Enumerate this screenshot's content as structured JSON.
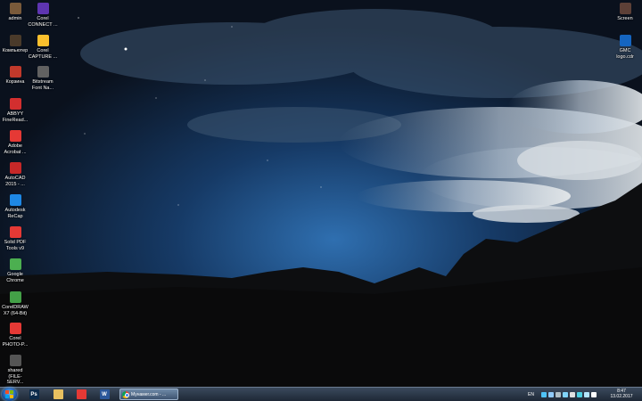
{
  "desktop": {
    "icons": [
      {
        "label": "admin",
        "icon": "user-folder-icon",
        "color": "#7a5a3a"
      },
      {
        "label": "Компьютер",
        "icon": "computer-icon",
        "color": "#4a3a2a"
      },
      {
        "label": "Корзина",
        "icon": "recycle-bin-icon",
        "color": "#c0392b"
      },
      {
        "label": "ABBYY\nFineRead...",
        "icon": "abbyy-icon",
        "color": "#d32f2f"
      },
      {
        "label": "Adobe\nAcrobat ...",
        "icon": "adobe-acrobat-icon",
        "color": "#e53935"
      },
      {
        "label": "AutoCAD\n2015 - ...",
        "icon": "autocad-icon",
        "color": "#c62828"
      },
      {
        "label": "Autodesk\nReCap",
        "icon": "autodesk-recap-icon",
        "color": "#1e88e5"
      },
      {
        "label": "Solid PDF\nTools v9",
        "icon": "solid-pdf-icon",
        "color": "#e53935"
      },
      {
        "label": "Google\nChrome",
        "icon": "chrome-icon",
        "color": "#4caf50"
      },
      {
        "label": "CorelDRAW\nX7 (64-Bit)",
        "icon": "coreldraw-icon",
        "color": "#43a047"
      },
      {
        "label": "Corel\nPHOTO-P...",
        "icon": "corel-photo-paint-icon",
        "color": "#e53935"
      },
      {
        "label": "shared\n(FILE-SERV...",
        "icon": "network-share-icon",
        "color": "#555555"
      },
      {
        "label": "Corel\nCONNECT ...",
        "icon": "corel-connect-icon",
        "color": "#5e35b1"
      },
      {
        "label": "Corel\nCAPTURE ...",
        "icon": "corel-capture-icon",
        "color": "#fbc02d"
      },
      {
        "label": "Bitstream\nFont Na...",
        "icon": "bitstream-font-icon",
        "color": "#616161"
      },
      {
        "label": "Screen",
        "icon": "screen-icon",
        "color": "#5d4037"
      },
      {
        "label": "GMC\nlogo.cdr",
        "icon": "cdr-file-icon",
        "color": "#1565c0"
      }
    ]
  },
  "taskbar": {
    "pinned": [
      {
        "icon": "photoshop-icon",
        "text": "Ps",
        "color": "#0b2a4a"
      },
      {
        "icon": "file-explorer-icon",
        "text": "",
        "color": "#e8c060"
      },
      {
        "icon": "adobe-reader-icon",
        "text": "",
        "color": "#e53935"
      },
      {
        "icon": "word-icon",
        "text": "W",
        "color": "#2b579a"
      }
    ],
    "active_window": {
      "title": "Мунамег.com - ...",
      "icon": "chrome-icon"
    },
    "tray": {
      "language": "EN",
      "time": "8:47",
      "date": "13.02.2017",
      "icon_colors": [
        "#4fc3f7",
        "#90caf9",
        "#b0bec5",
        "#81d4fa",
        "#e0e0e0",
        "#4dd0e1",
        "#b3e5fc",
        "#ffffff"
      ]
    }
  }
}
